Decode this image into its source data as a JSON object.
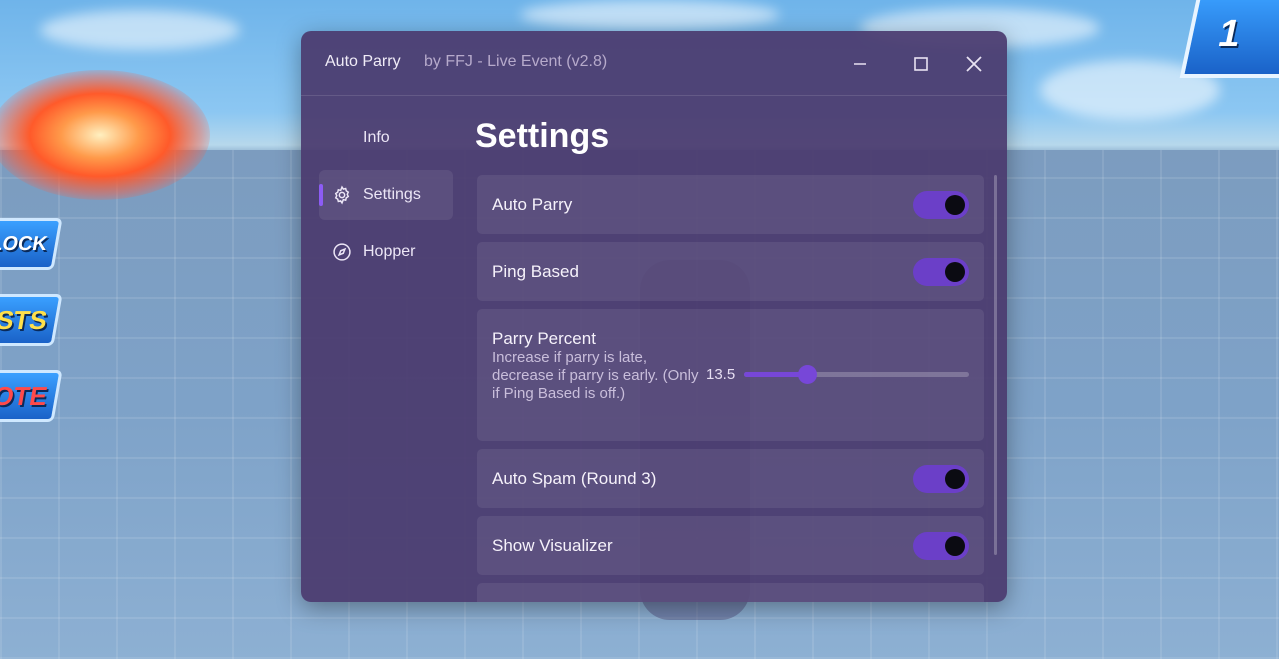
{
  "window": {
    "title": "Auto Parry",
    "subtitle": "by FFJ - Live Event (v2.8)",
    "controls": {
      "minimize_icon": "minimize-icon",
      "maximize_icon": "maximize-icon",
      "close_icon": "close-icon"
    }
  },
  "sidebar": {
    "items": [
      {
        "label": "Info",
        "icon": "",
        "active": false
      },
      {
        "label": "Settings",
        "icon": "gear-icon",
        "active": true
      },
      {
        "label": "Hopper",
        "icon": "compass-icon",
        "active": false
      }
    ]
  },
  "page": {
    "title": "Settings"
  },
  "settings": {
    "auto_parry": {
      "label": "Auto Parry",
      "enabled": true
    },
    "ping_based": {
      "label": "Ping Based",
      "enabled": true
    },
    "parry_percent": {
      "label": "Parry Percent",
      "description": "Increase if parry is late, decrease if parry is early. (Only if Ping Based is off.)",
      "value": "13.5",
      "slider_fraction": 0.28
    },
    "auto_spam": {
      "label": "Auto Spam (Round 3)",
      "enabled": true
    },
    "show_visualizer": {
      "label": "Show Visualizer",
      "enabled": true
    }
  },
  "background": {
    "hud_left": [
      "LOCK",
      "STS",
      "OTE"
    ],
    "hud_top_right": "1"
  },
  "colors": {
    "window_bg": "#4a3a6e",
    "accent": "#6b3fc8",
    "active_indicator": "#8d5cf5"
  }
}
